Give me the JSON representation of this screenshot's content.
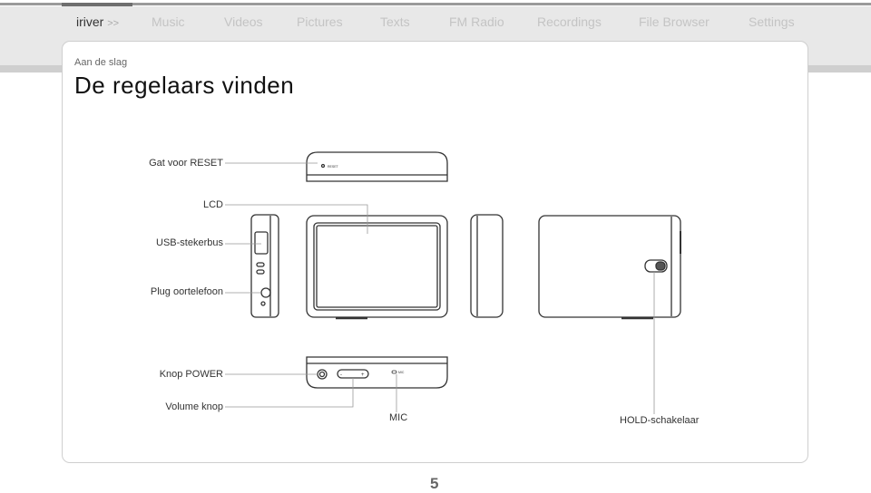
{
  "nav": {
    "brand": "iriver",
    "brand_arrow": ">>",
    "items": [
      "Music",
      "Videos",
      "Pictures",
      "Texts",
      "FM Radio",
      "Recordings",
      "File Browser",
      "Settings"
    ]
  },
  "breadcrumb": "Aan de slag",
  "title": "De regelaars vinden",
  "labels": {
    "reset": "Gat voor RESET",
    "lcd": "LCD",
    "usb": "USB-stekerbus",
    "earphone": "Plug oortelefoon",
    "power": "Knop POWER",
    "volume": "Volume knop",
    "mic": "MIC",
    "hold": "HOLD-schakelaar"
  },
  "device_marks": {
    "reset": "RESET",
    "mic": "MIC",
    "vol_minus": "-",
    "vol_plus": "+"
  },
  "page_number": "5"
}
